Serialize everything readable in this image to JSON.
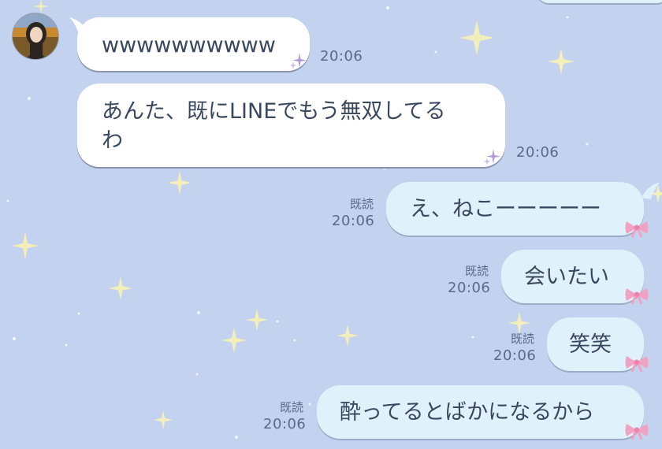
{
  "chat": {
    "incoming": [
      {
        "text": "wwwwwwwwww",
        "time": "20:06"
      },
      {
        "line1": "あんた、既にLINEでもう無双してる",
        "line2": "わ",
        "time": "20:06"
      }
    ],
    "outgoing": [
      {
        "text": "え、ねこーーーーー",
        "read": "既読",
        "time": "20:06"
      },
      {
        "text": "会いたい",
        "read": "既読",
        "time": "20:06"
      },
      {
        "text": "笑笑",
        "read": "既読",
        "time": "20:06"
      },
      {
        "text": "酔ってるとばかになるから",
        "read": "既読",
        "time": "20:06"
      }
    ]
  },
  "theme": {
    "background": "#c3d2ef",
    "incoming_bubble": "#ffffff",
    "outgoing_bubble": "#dff1fb",
    "text": "#39475f",
    "meta_text": "#5b6a85",
    "bow": "#f0a2c2"
  },
  "icons": {
    "avatar": "contact-avatar-photo",
    "incoming_deco": "purple-sparkle-icon",
    "outgoing_deco": "pink-ribbon-bow-icon",
    "background": "yellow-sparkle-stars"
  }
}
